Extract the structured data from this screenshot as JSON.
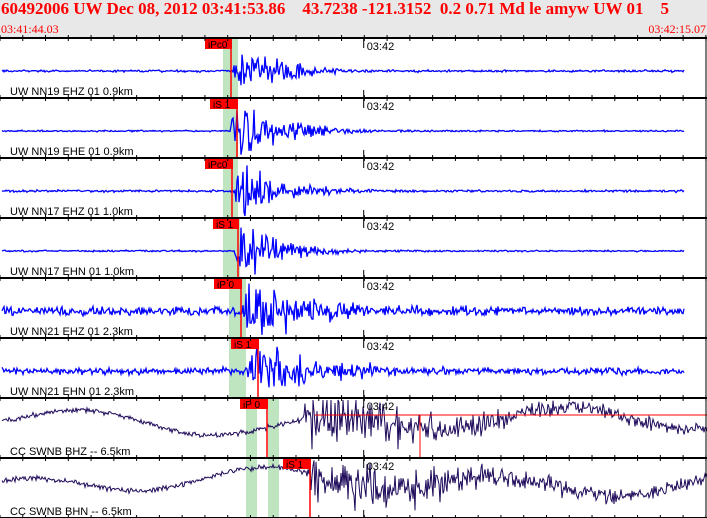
{
  "header": {
    "title": "60492006 UW Dec 08, 2012 03:41:53.86    43.7238 -121.3152  0.2 0.71 Md le amyw UW 01    5",
    "start_time": "03:41:44.03",
    "end_time": "03:42:15.07"
  },
  "chart_data": {
    "type": "line",
    "x_range": [
      "03:41:44.03",
      "03:42:15.07"
    ],
    "tick_interval_s": 1,
    "minute_label": "03:42",
    "colors": {
      "trace_short_period": "#0000ff",
      "trace_broadband": "#1e0a5a",
      "pick": "#ff0000",
      "window": "#bfe5c0"
    },
    "traces": [
      {
        "station": "UW NN19 EHZ 01 0.9km",
        "pick": "iPc0"
      },
      {
        "station": "UW NN19 EHE 01 0.9km",
        "pick": "iS 1"
      },
      {
        "station": "UW NN17 EHZ 01 1.0km",
        "pick": "iPc0"
      },
      {
        "station": "UW NN17 EHN 01 1.0km",
        "pick": "iS 1"
      },
      {
        "station": "UW NN21 EHZ 01 2.3km",
        "pick": "iP 0"
      },
      {
        "station": "UW NN21 EHN 01 2.3km",
        "pick": "iS 1"
      },
      {
        "station": "CC SWNB BHZ -- 6.5km",
        "pick": "iP 0"
      },
      {
        "station": "CC SWNB BHN -- 6.5km",
        "pick": "iS 1"
      }
    ]
  }
}
